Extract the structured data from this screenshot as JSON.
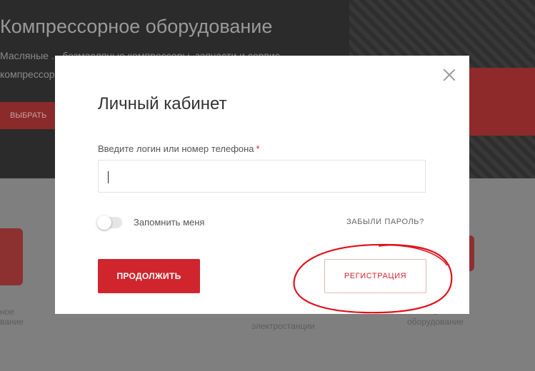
{
  "background": {
    "hero_title": "Компрессорное оборудование",
    "hero_line_1": "Масляные ... безмасляные компрессоры, запчасти и сервис",
    "hero_line_2": "компрессорного",
    "hero_button": "ВЫБРАТЬ",
    "products": [
      {
        "line1": "ное",
        "line2": "вание"
      },
      {
        "line1": "",
        "line2": "электростанции"
      },
      {
        "line1": "е",
        "line2": "оборудование"
      }
    ]
  },
  "modal": {
    "title": "Личный кабинет",
    "login_label": "Введите логин или номер телефона",
    "required_mark": "*",
    "login_value": "",
    "remember_label": "Запомнить меня",
    "remember_checked": false,
    "forgot_link": "ЗАБЫЛИ ПАРОЛЬ?",
    "continue_button": "ПРОДОЛЖИТЬ",
    "register_button": "РЕГИСТРАЦИЯ"
  },
  "icons": {
    "close": "close-icon"
  },
  "colors": {
    "accent": "#d0252d",
    "annotation": "#e0101a"
  }
}
